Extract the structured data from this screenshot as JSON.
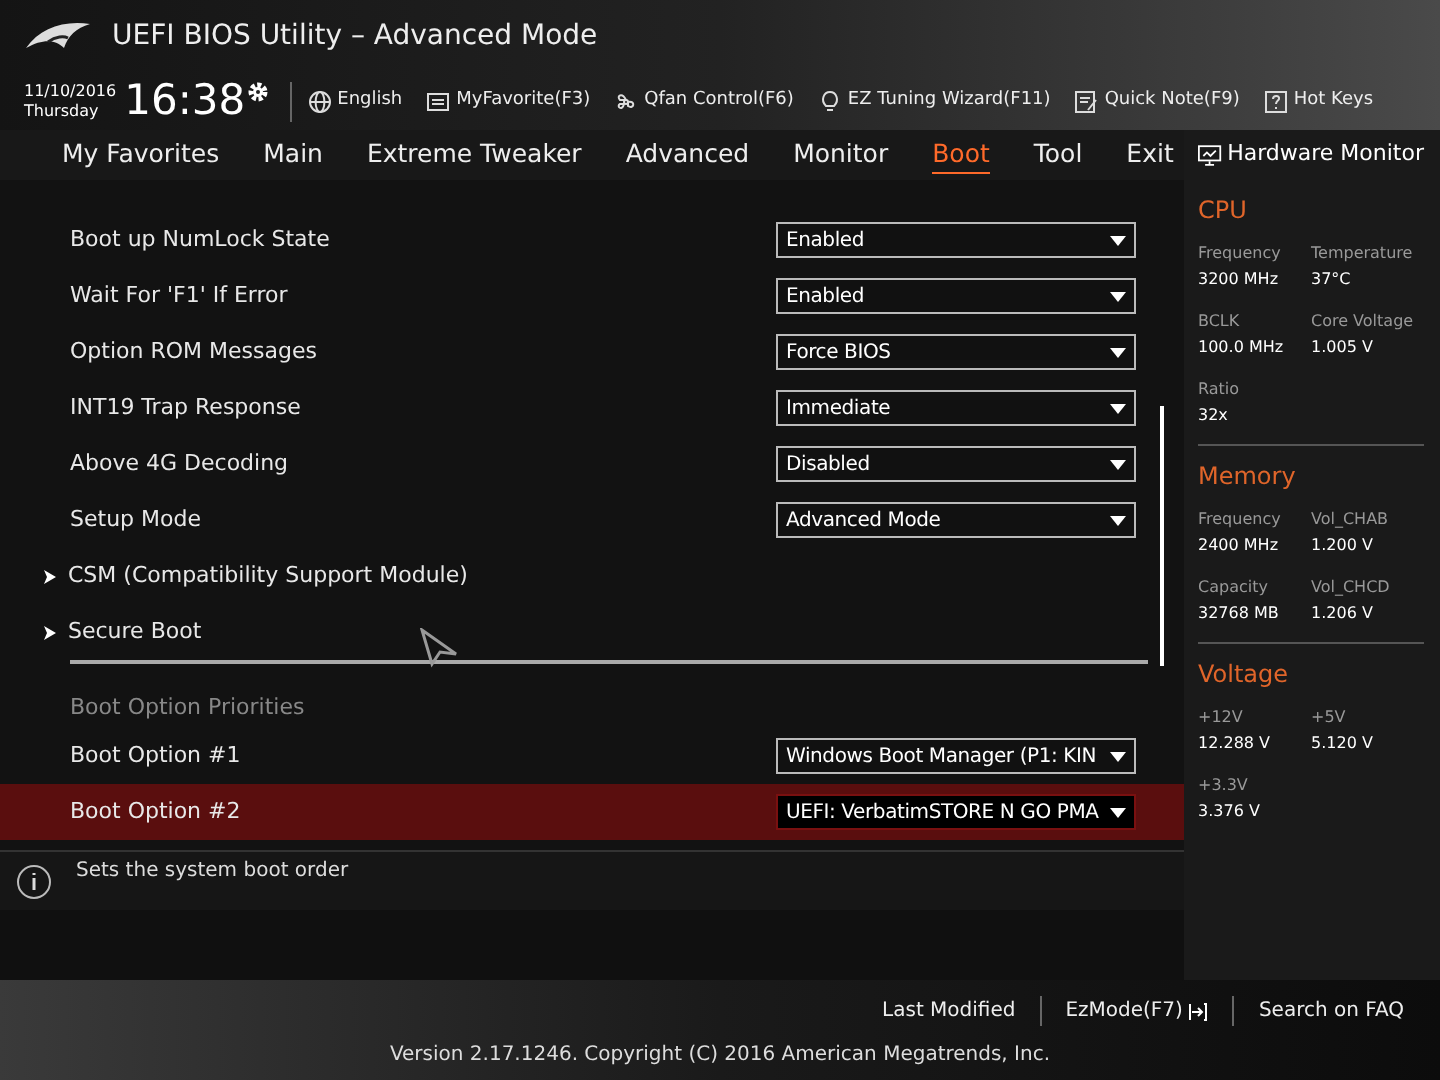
{
  "window": {
    "title": "UEFI BIOS Utility – Advanced Mode"
  },
  "clock": {
    "date": "11/10/2016",
    "day": "Thursday",
    "time": "16:38"
  },
  "toolbar": [
    {
      "label": "English",
      "kind": "globe"
    },
    {
      "label": "MyFavorite(F3)",
      "kind": "favorite"
    },
    {
      "label": "Qfan Control(F6)",
      "kind": "fan"
    },
    {
      "label": "EZ Tuning Wizard(F11)",
      "kind": "bulb"
    },
    {
      "label": "Quick Note(F9)",
      "kind": "note"
    },
    {
      "label": "Hot Keys",
      "kind": "help"
    }
  ],
  "tabs": [
    {
      "label": "My Favorites",
      "selected": false
    },
    {
      "label": "Main",
      "selected": false
    },
    {
      "label": "Extreme Tweaker",
      "selected": false
    },
    {
      "label": "Advanced",
      "selected": false
    },
    {
      "label": "Monitor",
      "selected": false
    },
    {
      "label": "Boot",
      "selected": true
    },
    {
      "label": "Tool",
      "selected": false
    },
    {
      "label": "Exit",
      "selected": false
    }
  ],
  "settings": [
    {
      "kind": "option",
      "label": "Boot up NumLock State",
      "value": "Enabled",
      "selected": false
    },
    {
      "kind": "option",
      "label": "Wait For 'F1' If Error",
      "value": "Enabled",
      "selected": false
    },
    {
      "kind": "option",
      "label": "Option ROM Messages",
      "value": "Force BIOS",
      "selected": false
    },
    {
      "kind": "option",
      "label": "INT19 Trap Response",
      "value": "Immediate",
      "selected": false
    },
    {
      "kind": "option",
      "label": "Above 4G Decoding",
      "value": "Disabled",
      "selected": false
    },
    {
      "kind": "option",
      "label": "Setup Mode",
      "value": "Advanced Mode",
      "selected": false
    },
    {
      "kind": "submenu",
      "label": "CSM (Compatibility Support Module)",
      "selected": false
    },
    {
      "kind": "submenu",
      "label": "Secure Boot",
      "selected": false
    },
    {
      "kind": "heading",
      "label": "Boot Option Priorities"
    },
    {
      "kind": "option",
      "label": "Boot Option #1",
      "value": "Windows Boot Manager (P1: KIN",
      "selected": false
    },
    {
      "kind": "option",
      "label": "Boot Option #2",
      "value": "UEFI: VerbatimSTORE N GO PMA",
      "selected": true
    }
  ],
  "help_text": "Sets the system boot order",
  "hardware_monitor": {
    "title": "Hardware Monitor",
    "sections": [
      {
        "title": "CPU",
        "items": [
          {
            "label": "Frequency",
            "value": "3200 MHz"
          },
          {
            "label": "Temperature",
            "value": "37°C"
          },
          {
            "label": "BCLK",
            "value": "100.0 MHz"
          },
          {
            "label": "Core Voltage",
            "value": "1.005 V"
          },
          {
            "label": "Ratio",
            "value": "32x"
          }
        ]
      },
      {
        "title": "Memory",
        "items": [
          {
            "label": "Frequency",
            "value": "2400 MHz"
          },
          {
            "label": "Vol_CHAB",
            "value": "1.200 V"
          },
          {
            "label": "Capacity",
            "value": "32768 MB"
          },
          {
            "label": "Vol_CHCD",
            "value": "1.206 V"
          }
        ]
      },
      {
        "title": "Voltage",
        "items": [
          {
            "label": "+12V",
            "value": "12.288 V"
          },
          {
            "label": "+5V",
            "value": "5.120 V"
          },
          {
            "label": "+3.3V",
            "value": "3.376 V"
          }
        ]
      }
    ]
  },
  "footer": {
    "links": [
      "Last Modified",
      "EzMode(F7)",
      "Search on FAQ"
    ],
    "version": "Version 2.17.1246. Copyright (C) 2016 American Megatrends, Inc."
  }
}
